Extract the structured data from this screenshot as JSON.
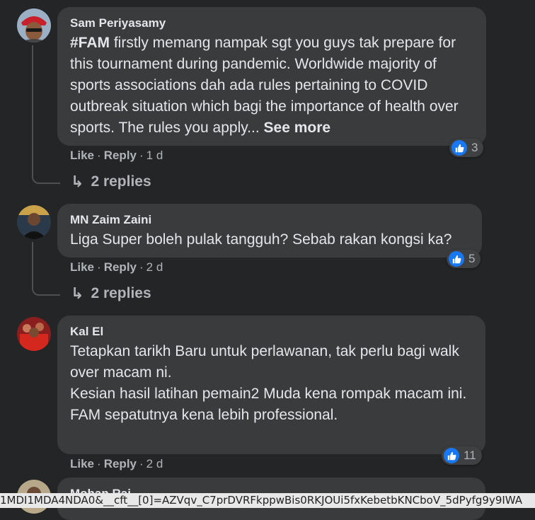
{
  "comments": [
    {
      "author": "Sam Periyasamy",
      "hashtag": "#FAM",
      "text": " firstly memang nampak sgt you guys tak prepare for this tournament during pandemic. Worldwide majority of sports associations dah ada rules pertaining to COVID outbreak situation which bagi the importance of health over sports. The rules you apply...",
      "see_more": "See more",
      "like": "Like",
      "reply": "Reply",
      "time": "1 d",
      "reactions": "3",
      "replies": "2 replies"
    },
    {
      "author": "MN Zaim Zaini",
      "text": "Liga Super boleh pulak tangguh? Sebab rakan kongsi ka?",
      "like": "Like",
      "reply": "Reply",
      "time": "2 d",
      "reactions": "5",
      "replies": "2 replies"
    },
    {
      "author": "Kal El",
      "lines": [
        "Tetapkan tarikh Baru untuk perlawanan, tak perlu bagi walk over macam ni.",
        "Kesian hasil latihan pemain2 Muda kena rompak macam ini.",
        "FAM sepatutnya kena lebih professional."
      ],
      "like": "Like",
      "reply": "Reply",
      "time": "2 d",
      "reactions": "11"
    },
    {
      "author": "Mohan Raj"
    }
  ],
  "separator": "·",
  "status_url": "1MDI1MDA4NDA0&__cft__[0]=AZVqv_C7prDVRFkppwBis0RKJOUi5fxKebetbKNCboV_5dPyfg9y9IWA"
}
